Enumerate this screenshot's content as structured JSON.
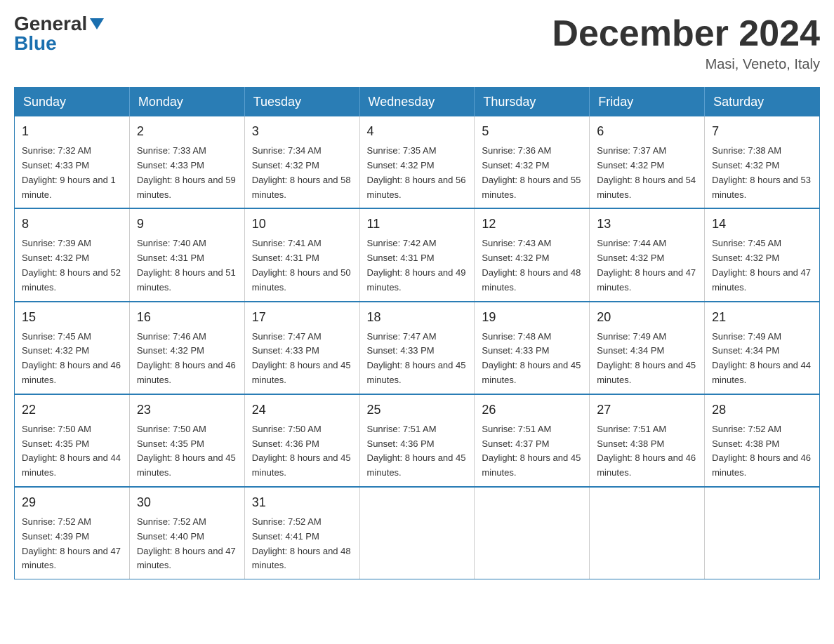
{
  "logo": {
    "general": "General",
    "blue": "Blue"
  },
  "title": "December 2024",
  "location": "Masi, Veneto, Italy",
  "days_of_week": [
    "Sunday",
    "Monday",
    "Tuesday",
    "Wednesday",
    "Thursday",
    "Friday",
    "Saturday"
  ],
  "weeks": [
    [
      {
        "day": "1",
        "sunrise": "7:32 AM",
        "sunset": "4:33 PM",
        "daylight": "9 hours and 1 minute."
      },
      {
        "day": "2",
        "sunrise": "7:33 AM",
        "sunset": "4:33 PM",
        "daylight": "8 hours and 59 minutes."
      },
      {
        "day": "3",
        "sunrise": "7:34 AM",
        "sunset": "4:32 PM",
        "daylight": "8 hours and 58 minutes."
      },
      {
        "day": "4",
        "sunrise": "7:35 AM",
        "sunset": "4:32 PM",
        "daylight": "8 hours and 56 minutes."
      },
      {
        "day": "5",
        "sunrise": "7:36 AM",
        "sunset": "4:32 PM",
        "daylight": "8 hours and 55 minutes."
      },
      {
        "day": "6",
        "sunrise": "7:37 AM",
        "sunset": "4:32 PM",
        "daylight": "8 hours and 54 minutes."
      },
      {
        "day": "7",
        "sunrise": "7:38 AM",
        "sunset": "4:32 PM",
        "daylight": "8 hours and 53 minutes."
      }
    ],
    [
      {
        "day": "8",
        "sunrise": "7:39 AM",
        "sunset": "4:32 PM",
        "daylight": "8 hours and 52 minutes."
      },
      {
        "day": "9",
        "sunrise": "7:40 AM",
        "sunset": "4:31 PM",
        "daylight": "8 hours and 51 minutes."
      },
      {
        "day": "10",
        "sunrise": "7:41 AM",
        "sunset": "4:31 PM",
        "daylight": "8 hours and 50 minutes."
      },
      {
        "day": "11",
        "sunrise": "7:42 AM",
        "sunset": "4:31 PM",
        "daylight": "8 hours and 49 minutes."
      },
      {
        "day": "12",
        "sunrise": "7:43 AM",
        "sunset": "4:32 PM",
        "daylight": "8 hours and 48 minutes."
      },
      {
        "day": "13",
        "sunrise": "7:44 AM",
        "sunset": "4:32 PM",
        "daylight": "8 hours and 47 minutes."
      },
      {
        "day": "14",
        "sunrise": "7:45 AM",
        "sunset": "4:32 PM",
        "daylight": "8 hours and 47 minutes."
      }
    ],
    [
      {
        "day": "15",
        "sunrise": "7:45 AM",
        "sunset": "4:32 PM",
        "daylight": "8 hours and 46 minutes."
      },
      {
        "day": "16",
        "sunrise": "7:46 AM",
        "sunset": "4:32 PM",
        "daylight": "8 hours and 46 minutes."
      },
      {
        "day": "17",
        "sunrise": "7:47 AM",
        "sunset": "4:33 PM",
        "daylight": "8 hours and 45 minutes."
      },
      {
        "day": "18",
        "sunrise": "7:47 AM",
        "sunset": "4:33 PM",
        "daylight": "8 hours and 45 minutes."
      },
      {
        "day": "19",
        "sunrise": "7:48 AM",
        "sunset": "4:33 PM",
        "daylight": "8 hours and 45 minutes."
      },
      {
        "day": "20",
        "sunrise": "7:49 AM",
        "sunset": "4:34 PM",
        "daylight": "8 hours and 45 minutes."
      },
      {
        "day": "21",
        "sunrise": "7:49 AM",
        "sunset": "4:34 PM",
        "daylight": "8 hours and 44 minutes."
      }
    ],
    [
      {
        "day": "22",
        "sunrise": "7:50 AM",
        "sunset": "4:35 PM",
        "daylight": "8 hours and 44 minutes."
      },
      {
        "day": "23",
        "sunrise": "7:50 AM",
        "sunset": "4:35 PM",
        "daylight": "8 hours and 45 minutes."
      },
      {
        "day": "24",
        "sunrise": "7:50 AM",
        "sunset": "4:36 PM",
        "daylight": "8 hours and 45 minutes."
      },
      {
        "day": "25",
        "sunrise": "7:51 AM",
        "sunset": "4:36 PM",
        "daylight": "8 hours and 45 minutes."
      },
      {
        "day": "26",
        "sunrise": "7:51 AM",
        "sunset": "4:37 PM",
        "daylight": "8 hours and 45 minutes."
      },
      {
        "day": "27",
        "sunrise": "7:51 AM",
        "sunset": "4:38 PM",
        "daylight": "8 hours and 46 minutes."
      },
      {
        "day": "28",
        "sunrise": "7:52 AM",
        "sunset": "4:38 PM",
        "daylight": "8 hours and 46 minutes."
      }
    ],
    [
      {
        "day": "29",
        "sunrise": "7:52 AM",
        "sunset": "4:39 PM",
        "daylight": "8 hours and 47 minutes."
      },
      {
        "day": "30",
        "sunrise": "7:52 AM",
        "sunset": "4:40 PM",
        "daylight": "8 hours and 47 minutes."
      },
      {
        "day": "31",
        "sunrise": "7:52 AM",
        "sunset": "4:41 PM",
        "daylight": "8 hours and 48 minutes."
      },
      null,
      null,
      null,
      null
    ]
  ]
}
